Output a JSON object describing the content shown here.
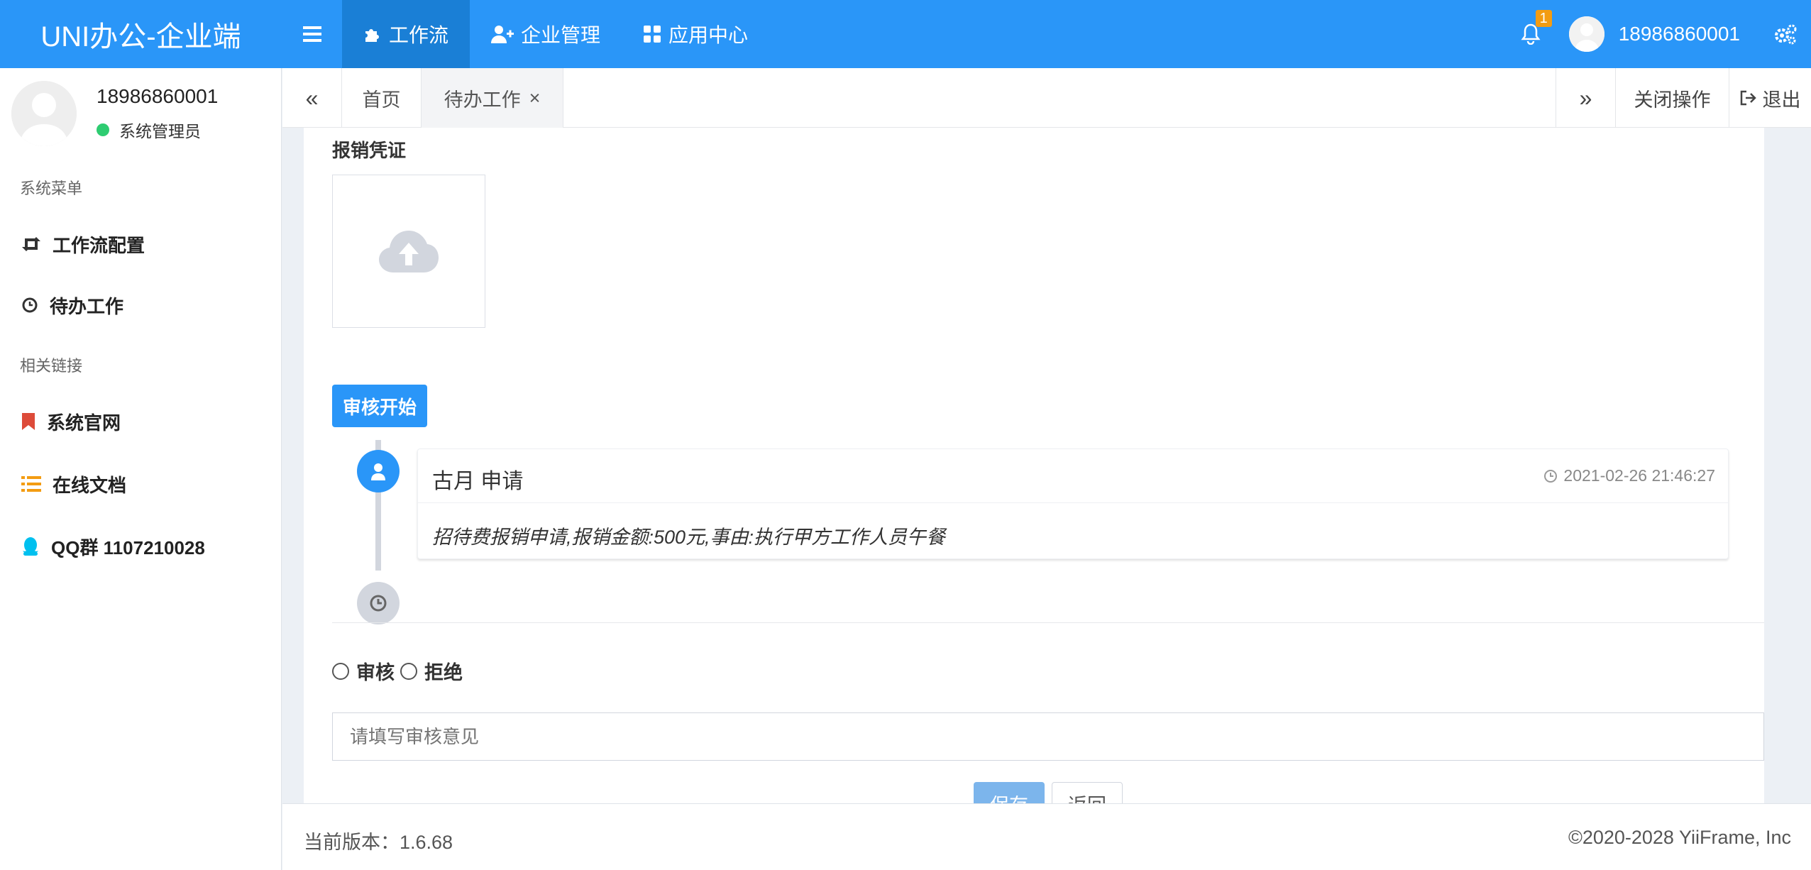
{
  "header": {
    "logo": "UNI办公-企业端",
    "nav": [
      {
        "label": "工作流",
        "icon": "puzzle-icon"
      },
      {
        "label": "企业管理",
        "icon": "user-plus-icon"
      },
      {
        "label": "应用中心",
        "icon": "grid-icon"
      }
    ],
    "notification_count": "1",
    "username": "18986860001"
  },
  "sidebar": {
    "username": "18986860001",
    "role": "系统管理员",
    "section1": "系统菜单",
    "section2": "相关链接",
    "items": [
      {
        "label": "工作流配置",
        "icon": "retweet-icon"
      },
      {
        "label": "待办工作",
        "icon": "clock-icon"
      },
      {
        "label": "系统官网",
        "icon": "bookmark-icon",
        "color": "#dd4b39"
      },
      {
        "label": "在线文档",
        "icon": "list-icon",
        "color": "#f39c12"
      },
      {
        "label": "QQ群 1107210028",
        "icon": "qq-icon",
        "color": "#00c0ef"
      }
    ]
  },
  "tabs": {
    "prev": "«",
    "next": "»",
    "items": [
      {
        "label": "首页"
      },
      {
        "label": "待办工作",
        "close": "×"
      }
    ],
    "close_ops": "关闭操作",
    "logout": "退出"
  },
  "form": {
    "voucher_label": "报销凭证",
    "timeline_start": "审核开始",
    "entry": {
      "title": "古月 申请",
      "time": "2021-02-26 21:46:27",
      "body": "招待费报销申请,报销金额:500元,事由:执行甲方工作人员午餐"
    },
    "radio_approve": "审核",
    "radio_reject": "拒绝",
    "opinion_placeholder": "请填写审核意见",
    "save": "保存",
    "back": "返回"
  },
  "footer": {
    "version": "当前版本：1.6.68",
    "copyright": "©2020-2028 YiiFrame, Inc"
  },
  "colors": {
    "primary": "#2a96f8",
    "nav_active": "#1a7fd6",
    "badge": "#f39c12",
    "online": "#2ecc71"
  }
}
